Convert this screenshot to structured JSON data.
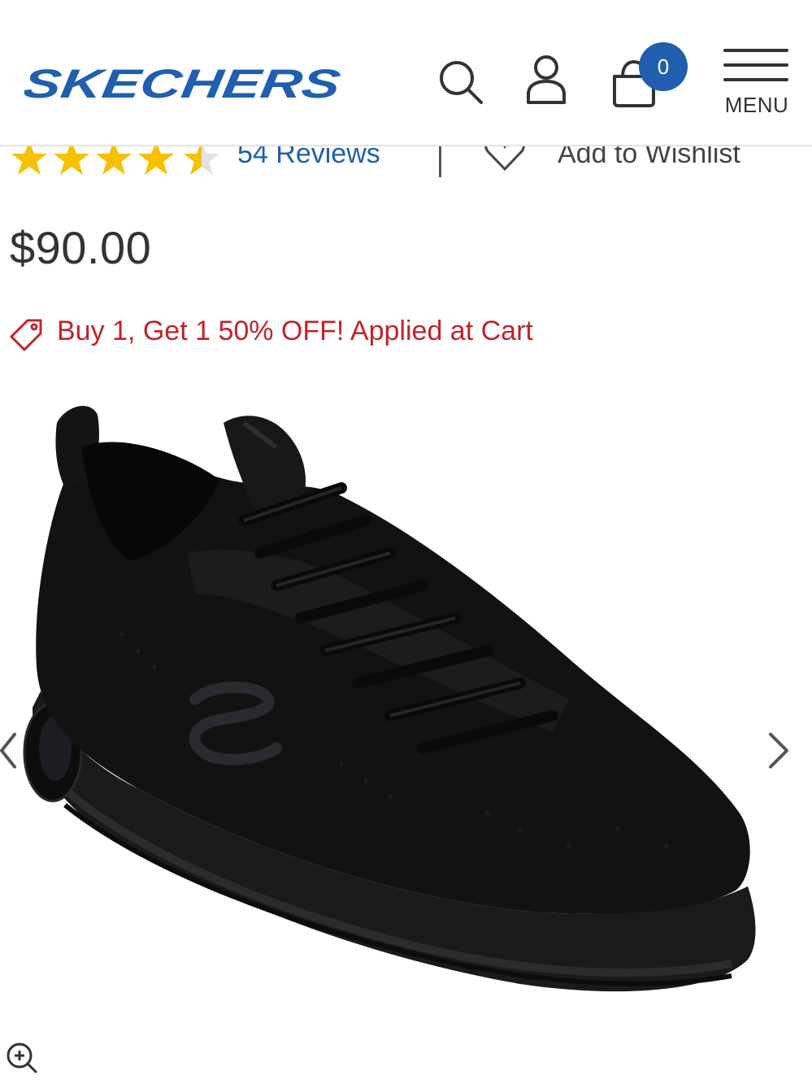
{
  "header": {
    "brand": "SKECHERS",
    "cart_count": "0",
    "menu_label": "MENU",
    "brand_color": "#1f5fae"
  },
  "rating": {
    "stars_value": 4.5,
    "stars_max": 5,
    "reviews_label": "54 Reviews",
    "wishlist_label": "Add to Wishlist",
    "star_color": "#f5c100"
  },
  "product": {
    "price": "$90.00",
    "promo_text": "Buy 1, Get 1 50% OFF! Applied at Cart",
    "promo_color": "#c0242b"
  },
  "icons": {
    "search": "search-icon",
    "account": "user-icon",
    "cart": "shopping-bag-icon",
    "menu": "hamburger-menu-icon",
    "wishlist": "heart-icon",
    "promo": "tag-icon",
    "prev": "chevron-left-icon",
    "next": "chevron-right-icon",
    "zoom": "zoom-in-icon"
  }
}
